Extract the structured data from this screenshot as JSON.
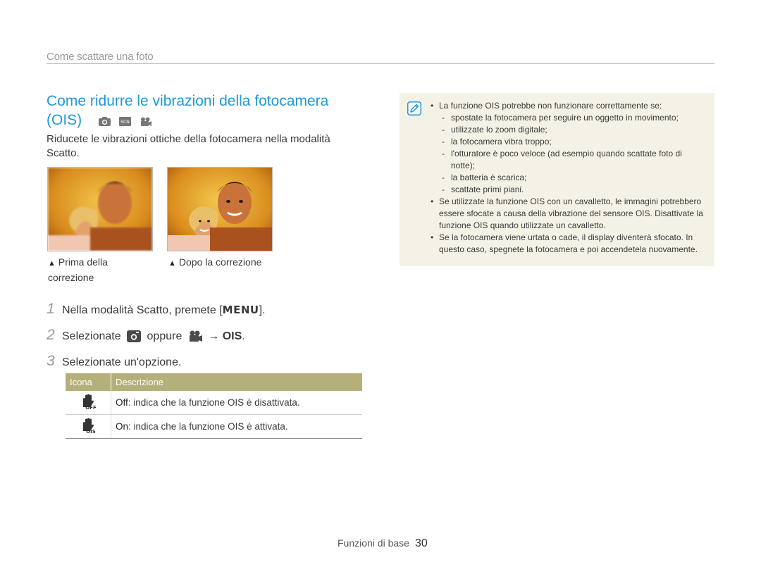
{
  "section_header": "Come scattare una foto",
  "title": {
    "line1": "Come ridurre le vibrazioni della fotocamera",
    "line2": "(OIS)",
    "mode_icons": [
      "camera-auto-icon",
      "scene-icon",
      "movie-icon"
    ]
  },
  "intro": "Riducete le vibrazioni ottiche della fotocamera nella modalità Scatto.",
  "photos": {
    "before_caption": "Prima della correzione",
    "after_caption": "Dopo la correzione"
  },
  "steps": [
    {
      "num": "1",
      "text": "Nella modalità Scatto, premete [",
      "key": "MENU",
      "text_after": "]."
    },
    {
      "num": "2",
      "text": "Selezionate",
      "or": "oppure",
      "arrow": "→",
      "target": "OIS",
      "end": "."
    },
    {
      "num": "3",
      "text": "Selezionate un'opzione."
    }
  ],
  "table": {
    "headers": [
      "Icona",
      "Descrizione"
    ],
    "rows": [
      {
        "icon": "ois-off-icon",
        "name": "Off",
        "desc": ": indica che la funzione OIS è disattivata."
      },
      {
        "icon": "ois-on-icon",
        "name": "On",
        "desc": ": indica che la funzione OIS è attivata."
      }
    ]
  },
  "notes": {
    "b1": "La funzione OIS potrebbe non funzionare correttamente se:",
    "subs": [
      "spostate la fotocamera per seguire un oggetto in movimento;",
      "utilizzate lo zoom digitale;",
      "la fotocamera vibra troppo;",
      "l'otturatore è poco veloce (ad esempio quando scattate foto di notte);",
      "la batteria è scarica;",
      "scattate primi piani."
    ],
    "b2": "Se utilizzate la funzione OIS con un cavalletto, le immagini potrebbero essere sfocate a causa della vibrazione del sensore OIS. Disattivate la funzione OIS quando utilizzate un cavalletto.",
    "b3": "Se la fotocamera viene urtata o cade, il display diventerà sfocato. In questo caso, spegnete la fotocamera e poi accendetela nuovamente."
  },
  "footer": {
    "label": "Funzioni di base",
    "page": "30"
  },
  "colors": {
    "title": "#1e9ad6",
    "table_header": "#b5b07a",
    "note_bg": "#f4f2e6"
  }
}
